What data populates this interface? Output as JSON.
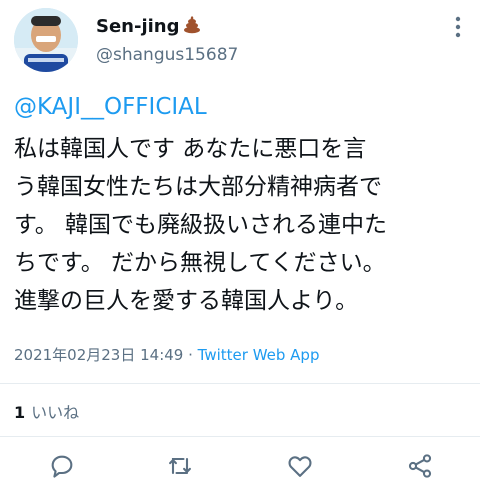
{
  "user": {
    "name": "Sen-jing",
    "name_emoji": "poop-icon",
    "handle": "@shangus15687"
  },
  "tweet": {
    "mention": "@KAJI__OFFICIAL",
    "lines": [
      " 私は韓国人です あなたに悪口を言",
      "う韓国女性たちは大部分精神病者で",
      "す。 韓国でも廃級扱いされる連中た",
      "ちです。 だから無視してください。",
      "進撃の巨人を愛する韓国人より。"
    ],
    "timestamp": "2021年02月23日 14:49",
    "separator": " · ",
    "source": "Twitter Web App"
  },
  "engagement": {
    "like_count": "1",
    "like_label": "いいね"
  },
  "actions": [
    "reply-icon",
    "retweet-icon",
    "like-icon",
    "share-icon"
  ],
  "colors": {
    "accent": "#1d9bf0",
    "text": "#0f1419",
    "secondary": "#5b7083"
  }
}
